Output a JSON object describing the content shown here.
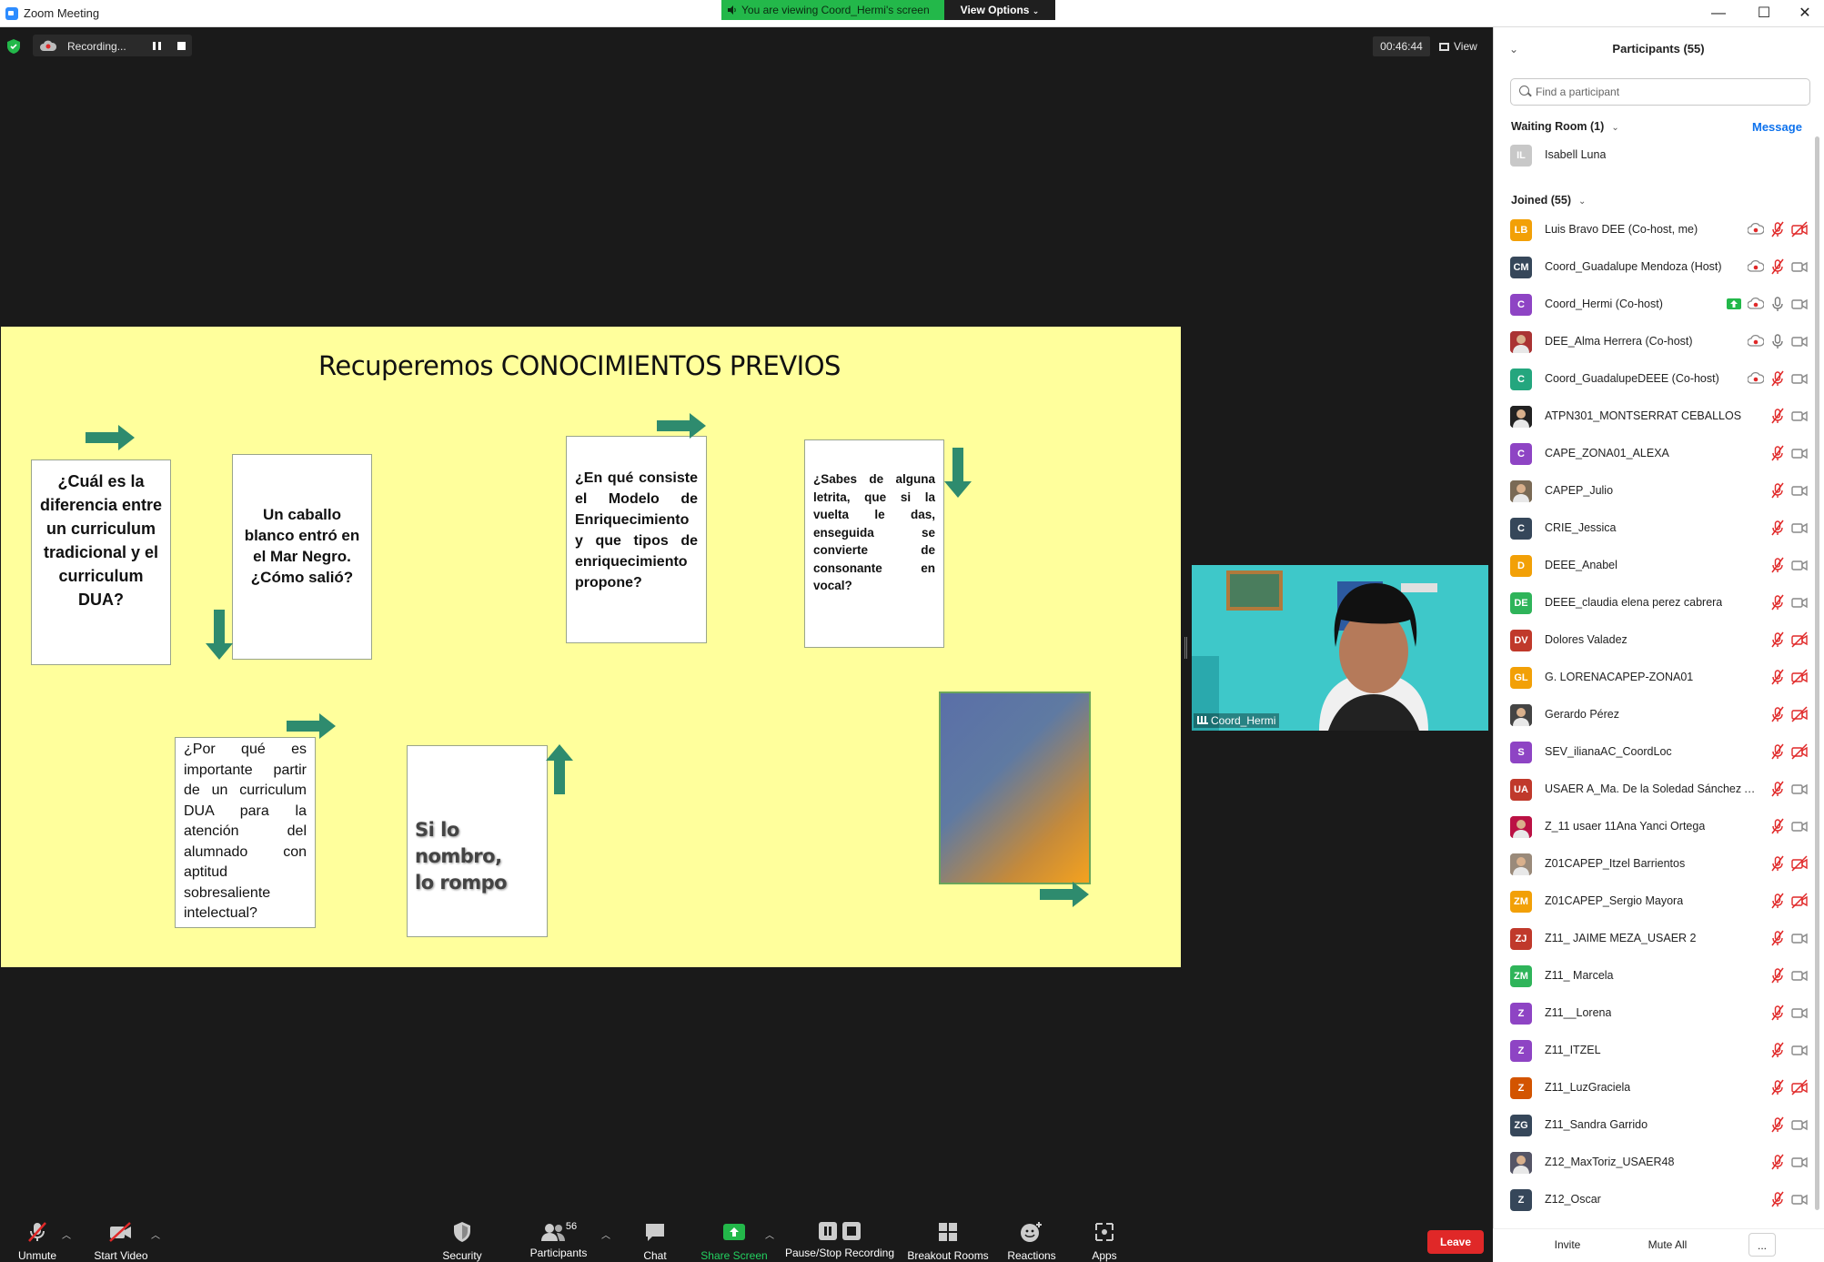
{
  "window": {
    "title": "Zoom Meeting",
    "viewing_banner": "You are viewing Coord_Hermi's screen",
    "view_options": "View Options",
    "minimize": "—",
    "maximize": "☐",
    "close": "✕"
  },
  "meeting": {
    "recording_label": "Recording...",
    "timer": "00:46:44",
    "view_label": "View",
    "video_name": "Coord_Hermi"
  },
  "slide": {
    "title": "Recuperemos CONOCIMIENTOS PREVIOS",
    "box1": "¿Cuál es la diferencia entre un curriculum tradicional y el curriculum DUA?",
    "box2": "Un caballo blanco entró en el Mar Negro. ¿Cómo salió?",
    "box3": "¿En qué consiste el Modelo de Enriquecimiento y que tipos de enriquecimiento propone?",
    "box4": "¿Sabes de alguna letrita, que si la vuelta le das, enseguida se convierte de consonante en vocal?",
    "box5": "¿Por qué es importante partir de un curriculum DUA para la atención del alumnado con aptitud sobresaliente intelectual?",
    "box6_line1": "Si lo nombro,",
    "box6_line2": "lo rompo"
  },
  "toolbar": {
    "unmute": "Unmute",
    "start_video": "Start Video",
    "security": "Security",
    "participants": "Participants",
    "participants_count": "56",
    "chat": "Chat",
    "share_screen": "Share Screen",
    "pause_stop_recording": "Pause/Stop Recording",
    "breakout_rooms": "Breakout Rooms",
    "reactions": "Reactions",
    "apps": "Apps",
    "leave": "Leave"
  },
  "panel": {
    "title": "Participants (55)",
    "search_placeholder": "Find a participant",
    "waiting_room_header": "Waiting Room (1)",
    "message_label": "Message",
    "waiting": [
      {
        "initials": "IL",
        "name": "Isabell Luna",
        "color": "#c8c8c8"
      }
    ],
    "joined_header": "Joined (55)",
    "participants": [
      {
        "initials": "LB",
        "name": "Luis Bravo DEE (Co-host, me)",
        "color": "#f2a007",
        "rec": true,
        "share": false,
        "mic": "muted",
        "cam": "off"
      },
      {
        "initials": "CM",
        "name": "Coord_Guadalupe Mendoza (Host)",
        "color": "#36475a",
        "rec": true,
        "share": false,
        "mic": "muted",
        "cam": "on"
      },
      {
        "initials": "C",
        "name": "Coord_Hermi (Co-host)",
        "color": "#8e44c4",
        "rec": true,
        "share": true,
        "mic": "on",
        "cam": "on"
      },
      {
        "initials": "",
        "name": "DEE_Alma Herrera (Co-host)",
        "color": "#a33",
        "photo": true,
        "rec": true,
        "share": false,
        "mic": "on",
        "cam": "on"
      },
      {
        "initials": "C",
        "name": "Coord_GuadalupeDEEE (Co-host)",
        "color": "#24a67e",
        "rec": true,
        "share": false,
        "mic": "muted",
        "cam": "on"
      },
      {
        "initials": "",
        "name": "ATPN301_MONTSERRAT CEBALLOS",
        "color": "#222",
        "photo": true,
        "rec": false,
        "share": false,
        "mic": "muted",
        "cam": "on"
      },
      {
        "initials": "C",
        "name": "CAPE_ZONA01_ALEXA",
        "color": "#8e44c4",
        "rec": false,
        "share": false,
        "mic": "muted",
        "cam": "on"
      },
      {
        "initials": "",
        "name": "CAPEP_Julio",
        "color": "#7a6a55",
        "photo": true,
        "rec": false,
        "share": false,
        "mic": "muted",
        "cam": "on"
      },
      {
        "initials": "C",
        "name": "CRIE_Jessica",
        "color": "#36475a",
        "rec": false,
        "share": false,
        "mic": "muted",
        "cam": "on"
      },
      {
        "initials": "D",
        "name": "DEEE_Anabel",
        "color": "#f2a007",
        "rec": false,
        "share": false,
        "mic": "muted",
        "cam": "on"
      },
      {
        "initials": "DE",
        "name": "DEEE_claudia elena perez cabrera",
        "color": "#2fb45a",
        "rec": false,
        "share": false,
        "mic": "muted",
        "cam": "on"
      },
      {
        "initials": "DV",
        "name": "Dolores Valadez",
        "color": "#c0392b",
        "rec": false,
        "share": false,
        "mic": "muted",
        "cam": "off"
      },
      {
        "initials": "GL",
        "name": "G. LORENACAPEP-ZONA01",
        "color": "#f2a007",
        "rec": false,
        "share": false,
        "mic": "muted",
        "cam": "off"
      },
      {
        "initials": "",
        "name": "Gerardo Pérez",
        "color": "#444",
        "photo": true,
        "rec": false,
        "share": false,
        "mic": "muted",
        "cam": "off"
      },
      {
        "initials": "S",
        "name": "SEV_ilianaAC_CoordLoc",
        "color": "#8e44c4",
        "rec": false,
        "share": false,
        "mic": "muted",
        "cam": "off"
      },
      {
        "initials": "UA",
        "name": "USAER A_Ma. De la Soledad Sánchez A...",
        "color": "#c0392b",
        "rec": false,
        "share": false,
        "mic": "muted",
        "cam": "on"
      },
      {
        "initials": "",
        "name": "Z_11 usaer 11Ana Yanci Ortega",
        "color": "#b14",
        "photo": true,
        "rec": false,
        "share": false,
        "mic": "muted",
        "cam": "on"
      },
      {
        "initials": "",
        "name": "Z01CAPEP_Itzel Barrientos",
        "color": "#9a8a7a",
        "photo": true,
        "rec": false,
        "share": false,
        "mic": "muted",
        "cam": "off"
      },
      {
        "initials": "ZM",
        "name": "Z01CAPEP_Sergio Mayora",
        "color": "#f2a007",
        "rec": false,
        "share": false,
        "mic": "muted",
        "cam": "off"
      },
      {
        "initials": "ZJ",
        "name": "Z11_ JAIME MEZA_USAER 2",
        "color": "#c0392b",
        "rec": false,
        "share": false,
        "mic": "muted",
        "cam": "on"
      },
      {
        "initials": "ZM",
        "name": "Z11_ Marcela",
        "color": "#2fb45a",
        "rec": false,
        "share": false,
        "mic": "muted",
        "cam": "on"
      },
      {
        "initials": "Z",
        "name": "Z11__Lorena",
        "color": "#8e44c4",
        "rec": false,
        "share": false,
        "mic": "muted",
        "cam": "on"
      },
      {
        "initials": "Z",
        "name": "Z11_ITZEL",
        "color": "#8e44c4",
        "rec": false,
        "share": false,
        "mic": "muted",
        "cam": "on"
      },
      {
        "initials": "Z",
        "name": "Z11_LuzGraciela",
        "color": "#d35400",
        "rec": false,
        "share": false,
        "mic": "muted",
        "cam": "off"
      },
      {
        "initials": "ZG",
        "name": "Z11_Sandra Garrido",
        "color": "#36475a",
        "rec": false,
        "share": false,
        "mic": "muted",
        "cam": "on"
      },
      {
        "initials": "",
        "name": "Z12_MaxToriz_USAER48",
        "color": "#556",
        "photo": true,
        "rec": false,
        "share": false,
        "mic": "muted",
        "cam": "on"
      },
      {
        "initials": "Z",
        "name": "Z12_Oscar",
        "color": "#36475a",
        "rec": false,
        "share": false,
        "mic": "muted",
        "cam": "on"
      }
    ],
    "invite": "Invite",
    "mute_all": "Mute All",
    "more": "..."
  }
}
